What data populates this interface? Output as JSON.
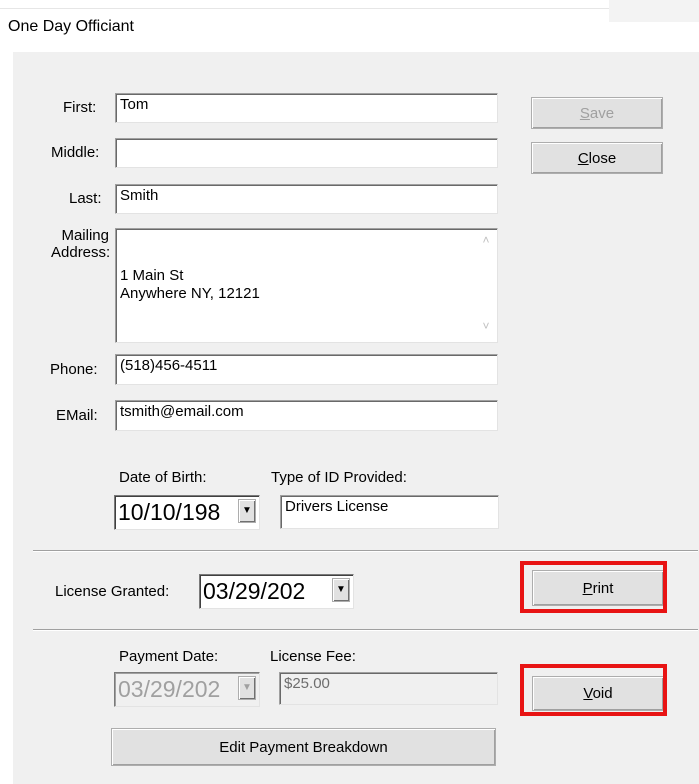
{
  "window": {
    "title": "One Day Officiant"
  },
  "form": {
    "first_label": "First:",
    "first_value": "Tom",
    "middle_label": "Middle:",
    "middle_value": "",
    "last_label": "Last:",
    "last_value": "Smith",
    "address_label_line1": "Mailing",
    "address_label_line2": "Address:",
    "address_value": "1 Main St\nAnywhere NY, 12121",
    "phone_label": "Phone:",
    "phone_value": "(518)456-4511",
    "email_label": "EMail:",
    "email_value": "tsmith@email.com",
    "dob_label": "Date of Birth:",
    "dob_value": "10/10/198",
    "id_type_label": "Type of ID Provided:",
    "id_type_value": "Drivers License",
    "license_granted_label": "License Granted:",
    "license_granted_value": "03/29/202",
    "payment_date_label": "Payment Date:",
    "payment_date_value": "03/29/202",
    "license_fee_label": "License Fee:",
    "license_fee_value": "$25.00"
  },
  "buttons": {
    "save_mnemonic": "S",
    "save_rest": "ave",
    "save_enabled": false,
    "close_mnemonic": "C",
    "close_rest": "lose",
    "print_mnemonic": "P",
    "print_rest": "rint",
    "void_mnemonic": "V",
    "void_rest": "oid",
    "edit_payment": "Edit Payment Breakdown"
  },
  "icons": {
    "dropdown": "chevron-down-icon",
    "scroll_up": "chevron-up-icon",
    "scroll_down": "chevron-down-icon"
  },
  "highlight_color": "#e81414"
}
